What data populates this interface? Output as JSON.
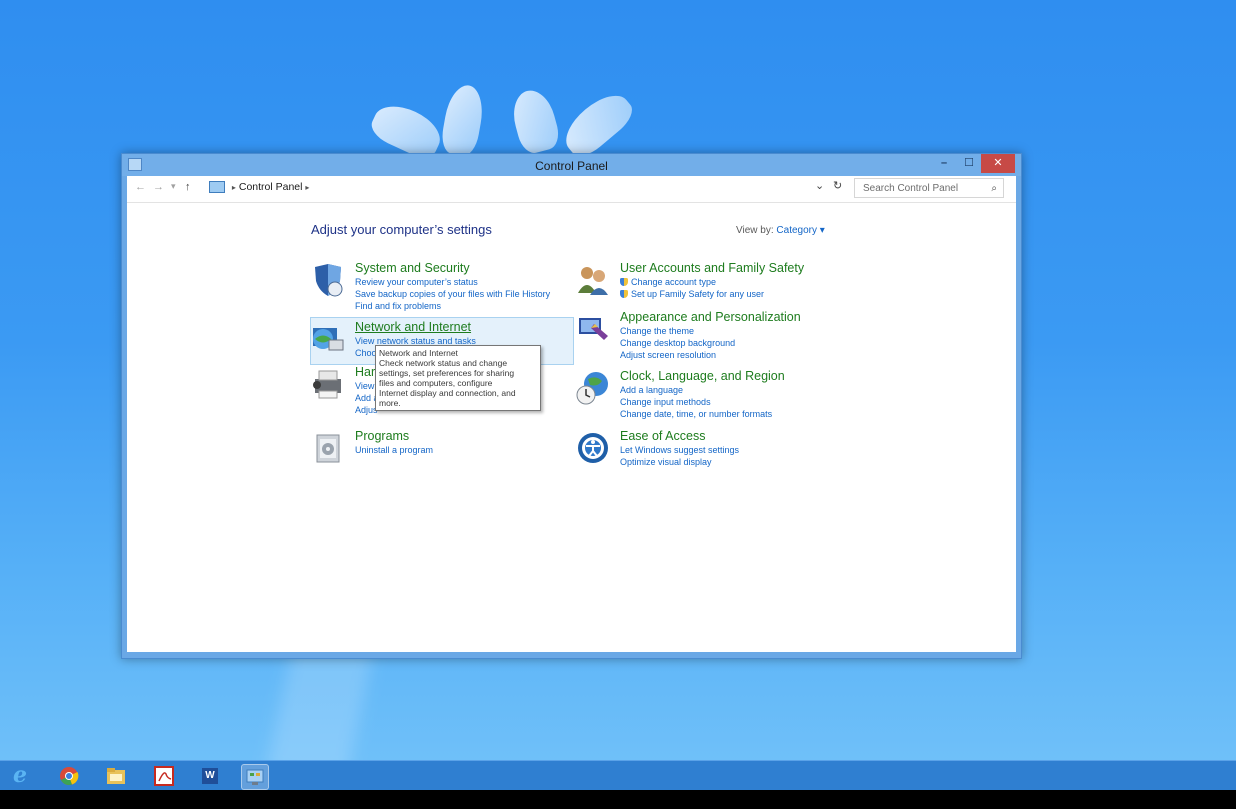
{
  "window": {
    "title": "Control Panel",
    "buttons": {
      "minimize": "–",
      "maximize": "☐",
      "close": "✕"
    }
  },
  "address_bar": {
    "back": "←",
    "forward": "→",
    "recent": "▾",
    "up": "↑",
    "breadcrumb_root": "Control Panel",
    "separator": "▸",
    "dropdown": "⌄",
    "refresh": "↻",
    "search_placeholder": "Search Control Panel",
    "search_icon": "⌕"
  },
  "content": {
    "heading": "Adjust your computer’s settings",
    "view_by_label": "View by:",
    "view_by_value": "Category ▾"
  },
  "categories_left": [
    {
      "title": "System and Security",
      "icon": "shield-icon",
      "links": [
        "Review your computer’s status",
        "Save backup copies of your files with File History",
        "Find and fix problems"
      ]
    },
    {
      "title": "Network and Internet",
      "icon": "globe-network-icon",
      "links": [
        "View network status and tasks",
        "Choo"
      ]
    },
    {
      "title": "Harc",
      "icon": "printer-icon",
      "links": [
        "View d",
        "Add a",
        "Adjus"
      ]
    },
    {
      "title": "Programs",
      "icon": "programs-icon",
      "links": [
        "Uninstall a program"
      ]
    }
  ],
  "categories_right": [
    {
      "title": "User Accounts and Family Safety",
      "icon": "users-icon",
      "links": [
        "Change account type",
        "Set up Family Safety for any user"
      ]
    },
    {
      "title": "Appearance and Personalization",
      "icon": "monitor-paint-icon",
      "links": [
        "Change the theme",
        "Change desktop background",
        "Adjust screen resolution"
      ]
    },
    {
      "title": "Clock, Language, and Region",
      "icon": "clock-globe-icon",
      "links": [
        "Add a language",
        "Change input methods",
        "Change date, time, or number formats"
      ]
    },
    {
      "title": "Ease of Access",
      "icon": "ease-of-access-icon",
      "links": [
        "Let Windows suggest settings",
        "Optimize visual display"
      ]
    }
  ],
  "tooltip": {
    "title": "Network and Internet",
    "lines": [
      "Check network status and change",
      "settings, set preferences for sharing",
      "files and computers, configure",
      "Internet display and connection, and",
      "more."
    ]
  },
  "taskbar": {
    "items": [
      "internet-explorer-icon",
      "chrome-icon",
      "file-explorer-icon",
      "adobe-reader-icon",
      "word-icon",
      "control-panel-icon"
    ],
    "ie_glyph": "e",
    "word_glyph": "W"
  }
}
